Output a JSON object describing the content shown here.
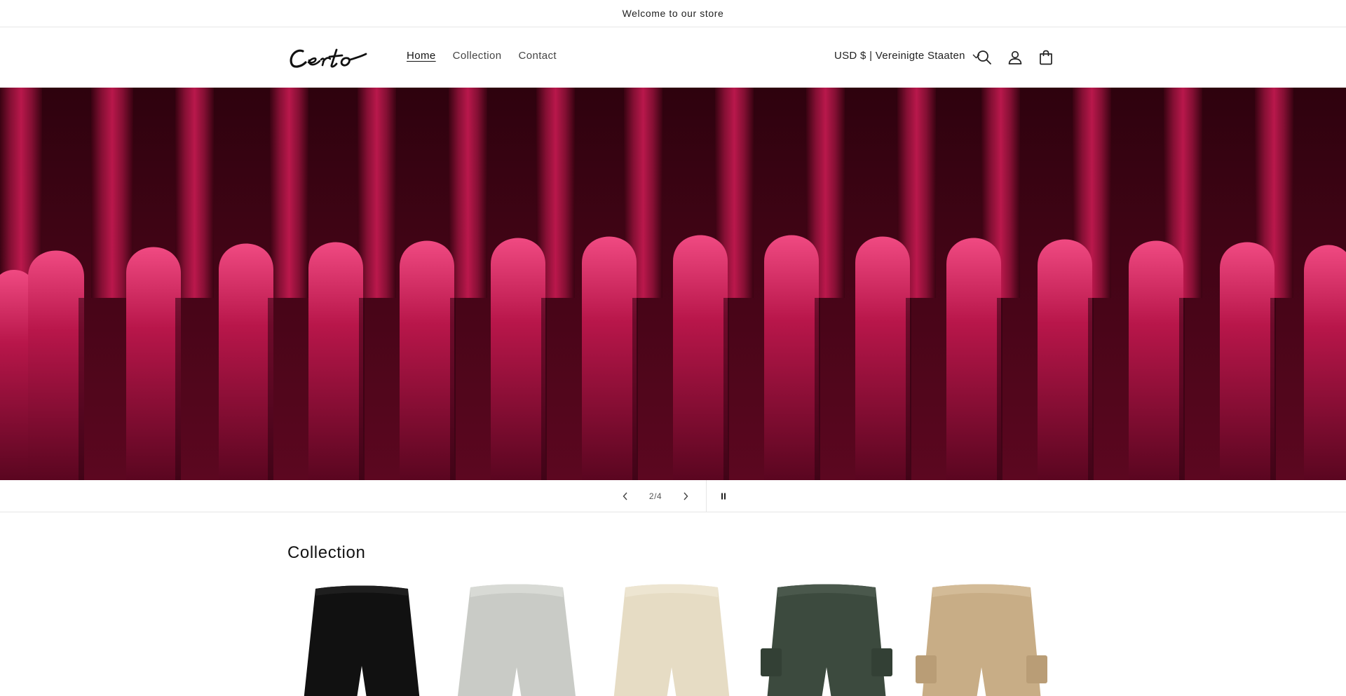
{
  "announcement": {
    "text": "Welcome to our store"
  },
  "header": {
    "logo_text": "Certo",
    "nav": [
      {
        "label": "Home",
        "active": true
      },
      {
        "label": "Collection",
        "active": false
      },
      {
        "label": "Contact",
        "active": false
      }
    ],
    "locale": "USD $ | Vereinigte Staaten",
    "icons": [
      "search-icon",
      "account-icon",
      "cart-icon"
    ]
  },
  "hero": {
    "image": "red-knit-ribbed-fabric",
    "accent_color": "#7a0c2e"
  },
  "slider": {
    "counter": "2/4",
    "prev_icon": "chevron-left-icon",
    "next_icon": "chevron-right-icon",
    "pause_icon": "pause-icon"
  },
  "collection": {
    "title": "Collection",
    "products": [
      {
        "image": "black-shorts",
        "color": "#111111"
      },
      {
        "image": "light-grey-shorts",
        "color": "#c9cbc6"
      },
      {
        "image": "cream-shorts",
        "color": "#e6dcc4"
      },
      {
        "image": "dark-green-cargo-shorts",
        "color": "#3c4a3e"
      },
      {
        "image": "khaki-cargo-shorts",
        "color": "#c8ad86"
      }
    ]
  }
}
